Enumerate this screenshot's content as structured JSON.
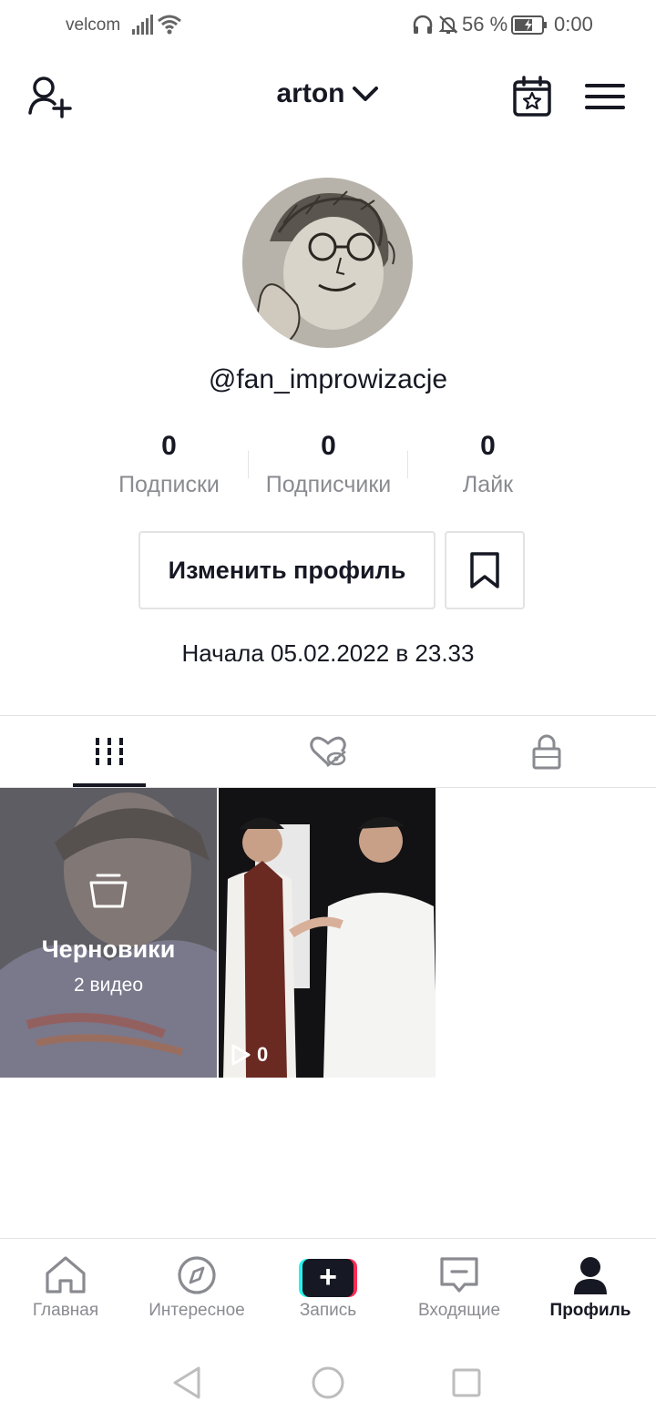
{
  "status_bar": {
    "carrier": "velcom",
    "battery_percent": "56 %",
    "time": "0:00"
  },
  "header": {
    "username": "arton",
    "icons": [
      "add-user-icon",
      "chevron-down-icon",
      "calendar-star-icon",
      "menu-icon"
    ]
  },
  "profile": {
    "handle": "@fan_improwizacje",
    "stats": [
      {
        "value": "0",
        "label": "Подписки"
      },
      {
        "value": "0",
        "label": "Подписчики"
      },
      {
        "value": "0",
        "label": "Лайк"
      }
    ],
    "edit_button": "Изменить профиль",
    "bio": "Начала 05.02.2022 в 23.33"
  },
  "tabs": [
    {
      "name": "videos",
      "icon": "grid-icon",
      "active": true
    },
    {
      "name": "liked",
      "icon": "hidden-heart-icon",
      "active": false
    },
    {
      "name": "private",
      "icon": "lock-icon",
      "active": false
    }
  ],
  "grid": {
    "drafts": {
      "label": "Черновики",
      "count": "2 видео"
    },
    "video": {
      "views": "0"
    }
  },
  "bottom_nav": [
    {
      "label": "Главная",
      "icon": "home-icon",
      "active": false
    },
    {
      "label": "Интересное",
      "icon": "compass-icon",
      "active": false
    },
    {
      "label": "Запись",
      "icon": "create-icon",
      "active": false
    },
    {
      "label": "Входящие",
      "icon": "inbox-icon",
      "active": false
    },
    {
      "label": "Профиль",
      "icon": "profile-icon",
      "active": true
    }
  ],
  "colors": {
    "text": "#161823",
    "secondary_text": "#8a8b91",
    "border": "#e3e3e4",
    "accent_cyan": "#25f4ee",
    "accent_red": "#fe2c55"
  }
}
